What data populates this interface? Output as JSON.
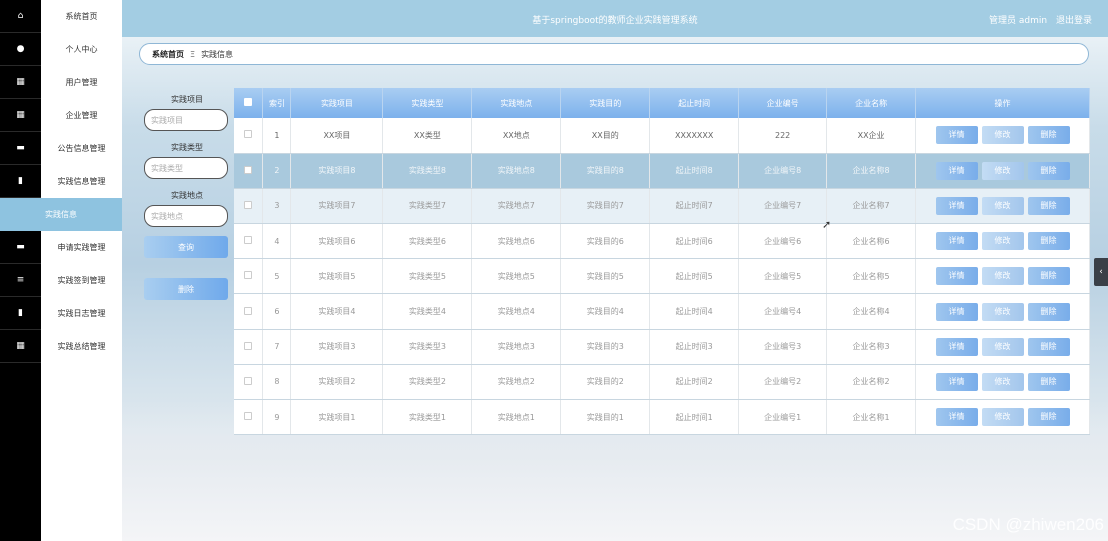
{
  "header": {
    "title": "基于springboot的教师企业实践管理系统",
    "user_label": "管理员 admin",
    "logout": "退出登录"
  },
  "menu": [
    {
      "label": "系统首页",
      "icon": "home-icon",
      "glyph": "⌂"
    },
    {
      "label": "个人中心",
      "icon": "user-icon",
      "glyph": "●"
    },
    {
      "label": "用户管理",
      "icon": "grid-icon",
      "glyph": "▦"
    },
    {
      "label": "企业管理",
      "icon": "grid-icon",
      "glyph": "▦"
    },
    {
      "label": "公告信息管理",
      "icon": "monitor-icon",
      "glyph": "▬"
    },
    {
      "label": "实践信息管理",
      "icon": "clipboard-icon",
      "glyph": "▮"
    },
    {
      "label": "实践信息",
      "icon": "",
      "glyph": ""
    },
    {
      "label": "申请实践管理",
      "icon": "ticket-icon",
      "glyph": "▬"
    },
    {
      "label": "实践签到管理",
      "icon": "list-icon",
      "glyph": "≡"
    },
    {
      "label": "实践日志管理",
      "icon": "bar-chart-icon",
      "glyph": "▮"
    },
    {
      "label": "实践总结管理",
      "icon": "grid-icon",
      "glyph": "▦"
    }
  ],
  "breadcrumb": {
    "home": "系统首页",
    "separator": "Ξ",
    "current": "实践信息"
  },
  "search": {
    "label1": "实践项目",
    "placeholder1": "实践项目",
    "label2": "实践类型",
    "placeholder2": "实践类型",
    "label3": "实践地点",
    "placeholder3": "实践地点",
    "query_button": "查询",
    "delete_button": "删除"
  },
  "table": {
    "columns": [
      "索引",
      "实践项目",
      "实践类型",
      "实践地点",
      "实践目的",
      "起止时间",
      "企业编号",
      "企业名称",
      "操作"
    ],
    "actions": {
      "detail": "详情",
      "edit": "修改",
      "delete": "删除"
    },
    "rows": [
      [
        "1",
        "XX项目",
        "XX类型",
        "XX地点",
        "XX目的",
        "XXXXXXX",
        "222",
        "XX企业"
      ],
      [
        "2",
        "实践项目8",
        "实践类型8",
        "实践地点8",
        "实践目的8",
        "起止时间8",
        "企业编号8",
        "企业名称8"
      ],
      [
        "3",
        "实践项目7",
        "实践类型7",
        "实践地点7",
        "实践目的7",
        "起止时间7",
        "企业编号7",
        "企业名称7"
      ],
      [
        "4",
        "实践项目6",
        "实践类型6",
        "实践地点6",
        "实践目的6",
        "起止时间6",
        "企业编号6",
        "企业名称6"
      ],
      [
        "5",
        "实践项目5",
        "实践类型5",
        "实践地点5",
        "实践目的5",
        "起止时间5",
        "企业编号5",
        "企业名称5"
      ],
      [
        "6",
        "实践项目4",
        "实践类型4",
        "实践地点4",
        "实践目的4",
        "起止时间4",
        "企业编号4",
        "企业名称4"
      ],
      [
        "7",
        "实践项目3",
        "实践类型3",
        "实践地点3",
        "实践目的3",
        "起止时间3",
        "企业编号3",
        "企业名称3"
      ],
      [
        "8",
        "实践项目2",
        "实践类型2",
        "实践地点2",
        "实践目的2",
        "起止时间2",
        "企业编号2",
        "企业名称2"
      ],
      [
        "9",
        "实践项目1",
        "实践类型1",
        "实践地点1",
        "实践目的1",
        "起止时间1",
        "企业编号1",
        "企业名称1"
      ]
    ]
  },
  "watermark": "CSDN @zhiwen206"
}
